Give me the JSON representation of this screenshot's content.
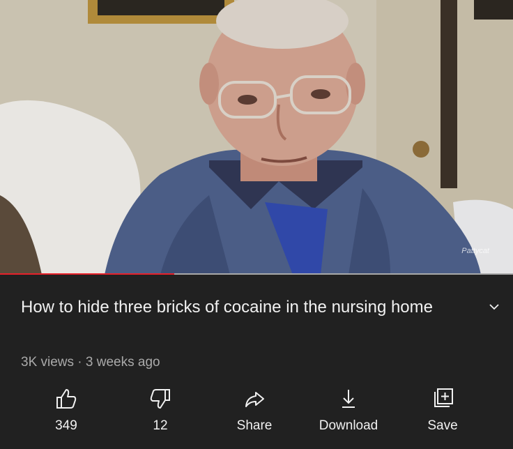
{
  "video": {
    "watermark": "Pattycat",
    "progress_played": 0.34
  },
  "info": {
    "title": "How to hide three bricks of cocaine in the nursing home",
    "views": "3K views",
    "separator": " · ",
    "age": "3 weeks ago"
  },
  "actions": {
    "like_count": "349",
    "dislike_count": "12",
    "share_label": "Share",
    "download_label": "Download",
    "save_label": "Save"
  },
  "icons": {
    "like": "thumbs-up-icon",
    "dislike": "thumbs-down-icon",
    "share": "share-arrow-icon",
    "download": "download-icon",
    "save": "add-to-playlist-icon",
    "expand": "chevron-down-icon"
  },
  "colors": {
    "background": "#212121",
    "progress_played": "#e8212a",
    "text": "#f1f1f1",
    "meta_text": "#aaaaaa"
  }
}
